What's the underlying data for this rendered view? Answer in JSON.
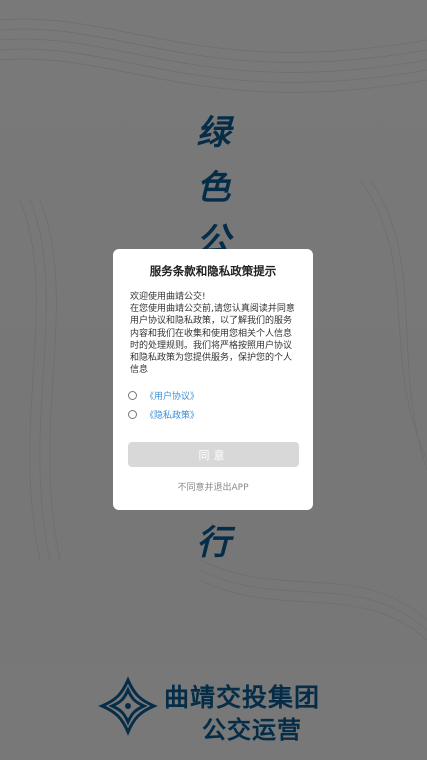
{
  "background": {
    "slogan_chars": [
      "绿",
      "色",
      "公",
      "行"
    ],
    "brand_name": "曲靖交投集团",
    "brand_sub": "公交运营",
    "brand_color": "#0b5b91"
  },
  "dialog": {
    "title": "服务条款和隐私政策提示",
    "greeting": "欢迎使用曲靖公交!",
    "body": "在您使用曲靖公交前,请您认真阅读并同意用户协议和隐私政策，以了解我们的服务内容和我们在收集和使用您相关个人信息时的处理规则。我们将严格按照用户协议和隐私政策为您提供服务，保护您的个人信息",
    "options": [
      {
        "label": "《用户协议》",
        "checked": false
      },
      {
        "label": "《隐私政策》",
        "checked": false
      }
    ],
    "agree_label": "同意",
    "exit_label": "不同意并退出APP",
    "link_color": "#3a8fd6"
  }
}
